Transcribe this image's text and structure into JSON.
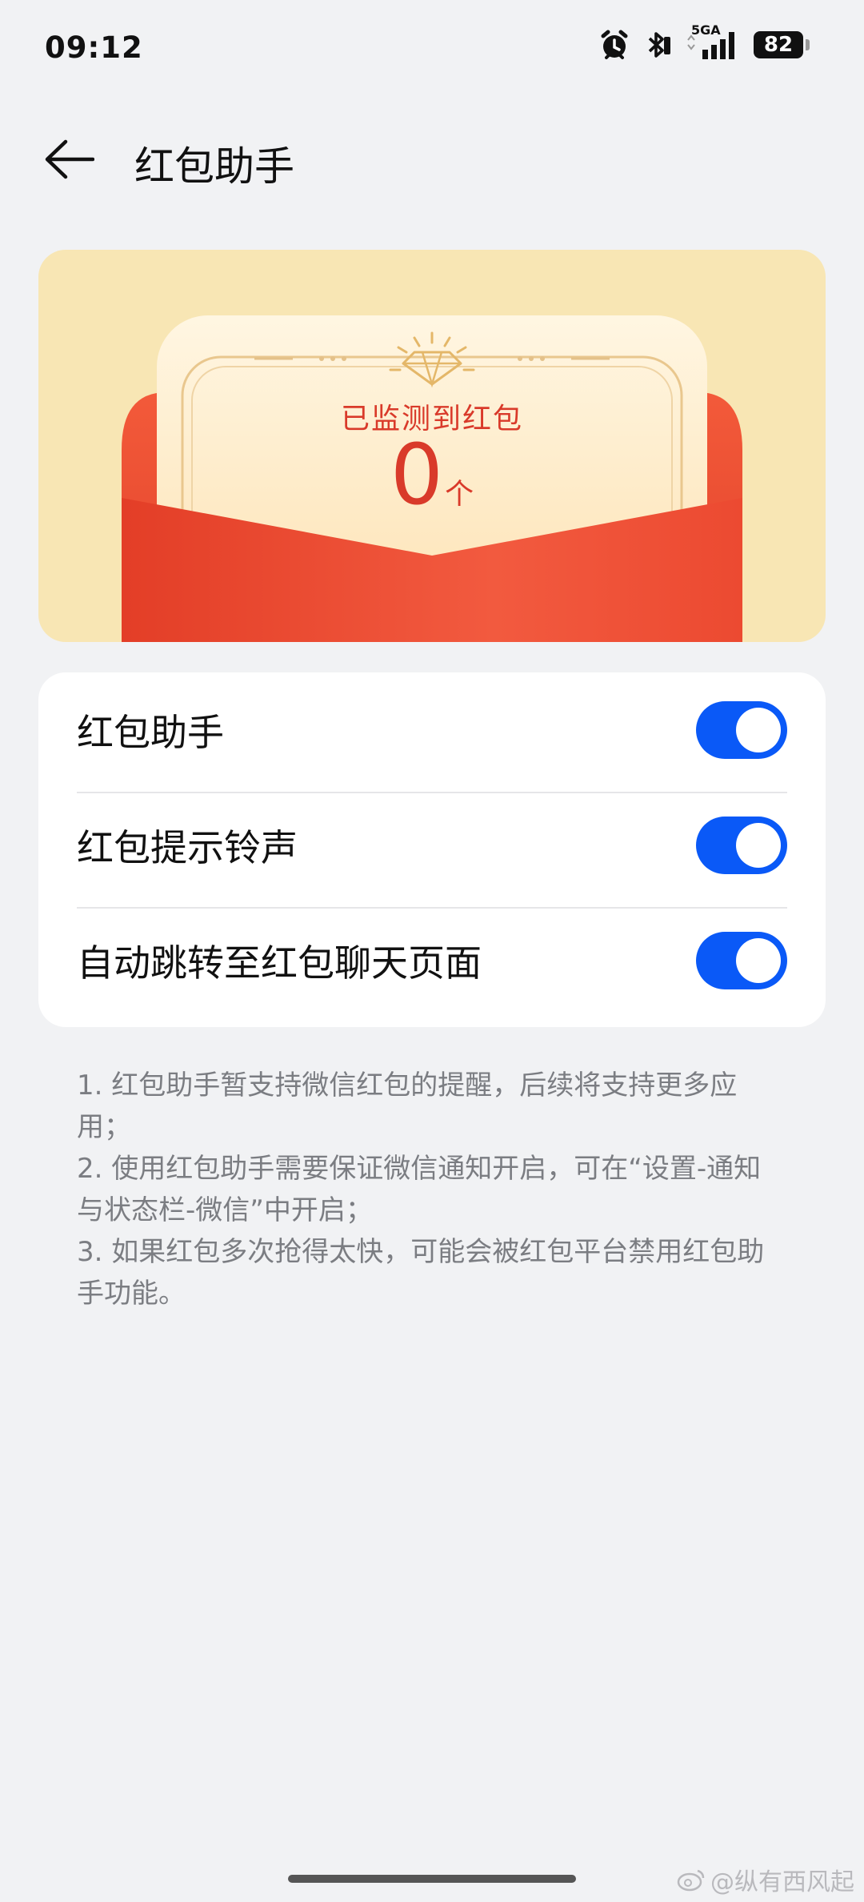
{
  "status_bar": {
    "time": "09:12",
    "network": "5GA",
    "battery": "82",
    "icons": [
      "alarm-icon",
      "bluetooth-icon",
      "signal-icon",
      "battery-icon"
    ]
  },
  "header": {
    "title": "红包助手"
  },
  "banner": {
    "label": "已监测到红包",
    "count": "0",
    "unit": "个"
  },
  "settings": [
    {
      "label": "红包助手",
      "enabled": true
    },
    {
      "label": "红包提示铃声",
      "enabled": true
    },
    {
      "label": "自动跳转至红包聊天页面",
      "enabled": true
    }
  ],
  "notes": [
    "1. 红包助手暂支持微信红包的提醒，后续将支持更多应用；",
    "2. 使用红包助手需要保证微信通知开启，可在“设置-通知与状态栏-微信”中开启；",
    "3. 如果红包多次抢得太快，可能会被红包平台禁用红包助手功能。"
  ],
  "watermark": "@纵有西风起",
  "colors": {
    "accent": "#0a59f7",
    "red": "#d93a2a",
    "banner_bg": "#f8e6b4"
  }
}
